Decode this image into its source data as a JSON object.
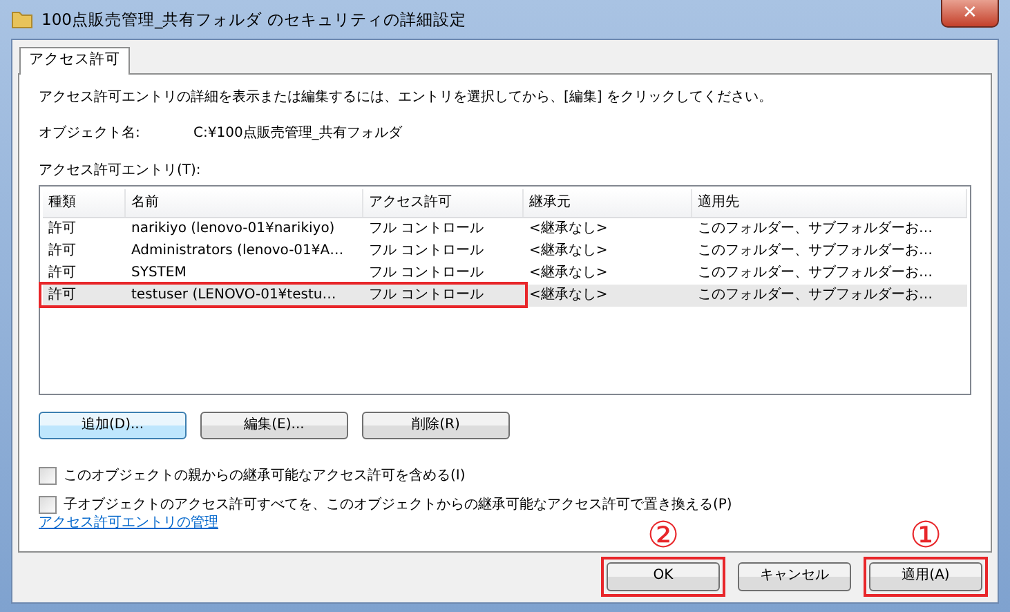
{
  "window": {
    "title": "100点販売管理_共有フォルダ のセキュリティの詳細設定",
    "close_glyph": "✕"
  },
  "tabs": [
    {
      "label": "アクセス許可",
      "selected": true
    }
  ],
  "instruction": "アクセス許可エントリの詳細を表示または編集するには、エントリを選択してから、[編集] をクリックしてください。",
  "object": {
    "label": "オブジェクト名:",
    "value": "C:¥100点販売管理_共有フォルダ"
  },
  "entries_label": "アクセス許可エントリ(T):",
  "table": {
    "columns": [
      "種類",
      "名前",
      "アクセス許可",
      "継承元",
      "適用先"
    ],
    "rows": [
      {
        "cells": [
          "許可",
          "narikiyo (lenovo-01¥narikiyo)",
          "フル コントロール",
          "<継承なし>",
          "このフォルダー、サブフォルダーお…"
        ],
        "selected": false,
        "highlighted": false
      },
      {
        "cells": [
          "許可",
          "Administrators (lenovo-01¥A…",
          "フル コントロール",
          "<継承なし>",
          "このフォルダー、サブフォルダーお…"
        ],
        "selected": false,
        "highlighted": false
      },
      {
        "cells": [
          "許可",
          "SYSTEM",
          "フル コントロール",
          "<継承なし>",
          "このフォルダー、サブフォルダーお…"
        ],
        "selected": false,
        "highlighted": false
      },
      {
        "cells": [
          "許可",
          "testuser (LENOVO-01¥testu…",
          "フル コントロール",
          "<継承なし>",
          "このフォルダー、サブフォルダーお…"
        ],
        "selected": true,
        "highlighted": true
      }
    ]
  },
  "entry_buttons": [
    {
      "label": "追加(D)...",
      "focused": true
    },
    {
      "label": "編集(E)...",
      "focused": false
    },
    {
      "label": "削除(R)",
      "focused": false
    }
  ],
  "checkboxes": [
    {
      "label": "このオブジェクトの親からの継承可能なアクセス許可を含める(I)",
      "checked": false
    },
    {
      "label": "子オブジェクトのアクセス許可すべてを、このオブジェクトからの継承可能なアクセス許可で置き換える(P)",
      "checked": false
    }
  ],
  "link": "アクセス許可エントリの管理",
  "dialog_buttons": [
    {
      "label": "OK",
      "highlighted": true,
      "annotation": "②"
    },
    {
      "label": "キャンセル",
      "highlighted": false
    },
    {
      "label": "適用(A)",
      "highlighted": true,
      "annotation": "①"
    }
  ]
}
